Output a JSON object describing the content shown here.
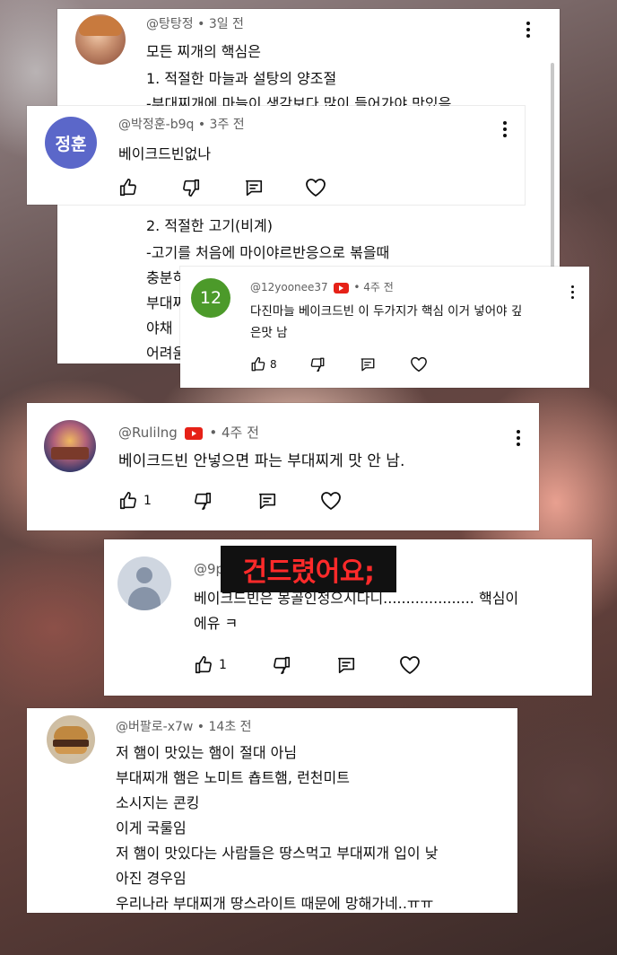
{
  "c1": {
    "handle": "@탕탕정",
    "time": "3일 전",
    "lines": [
      "모든 찌개의 핵심은",
      "1. 적절한 마늘과 설탕의 양조절",
      "-부대찌개에 마늘이 생각보다 많이 들어가야 맛있음"
    ],
    "lines_b": [
      "2. 적절한 고기(비계)",
      "-고기를 처음에 마이야르반응으로 볶을때",
      "충분히",
      "부대찌",
      "야채",
      "어려움"
    ]
  },
  "c2": {
    "avatar_text": "정훈",
    "avatar_color": "#5b67c9",
    "handle": "@박정훈-b9q",
    "time": "3주 전",
    "text": "베이크드빈없나"
  },
  "c3": {
    "avatar_text": "12",
    "avatar_color": "#4c9a2a",
    "handle": "@12yoonee37",
    "time": "4주 전",
    "lines": [
      "다진마늘 베이크드빈 이 두가지가 핵심 이거 넣어야 깊",
      "은맛 남"
    ],
    "likes": "8"
  },
  "c4": {
    "handle": "@Rulilng",
    "time": "4주 전",
    "text": "베이크드빈 안넣으면 파는 부대찌게 맛 안 남.",
    "likes": "1"
  },
  "c5": {
    "handle": "@9p",
    "lines": [
      "베이크드빈은 몽골인정으시다니.................... 핵심이",
      "에유 ㅋ"
    ],
    "likes": "1"
  },
  "banner": {
    "text": "건드렸어요;"
  },
  "c6": {
    "handle": "@버팔로-x7w",
    "time": "14초 전",
    "lines": [
      "저 햄이 맛있는 햄이 절대 아님",
      "부대찌개 햄은 노미트 춉트햄, 런천미트",
      "소시지는 콘킹",
      "이게 국룰임",
      "저 햄이 맛있다는 사람들은 땅스먹고 부대찌개 입이 낮",
      "아진 경우임",
      "우리나라 부대찌개 땅스라이트 때문에 망해가네..ㅠㅠ"
    ]
  },
  "sep": " • ",
  "icons": [
    "like-icon",
    "dislike-icon",
    "reply-icon",
    "heart-icon",
    "more-icon",
    "youtube-badge-icon"
  ]
}
